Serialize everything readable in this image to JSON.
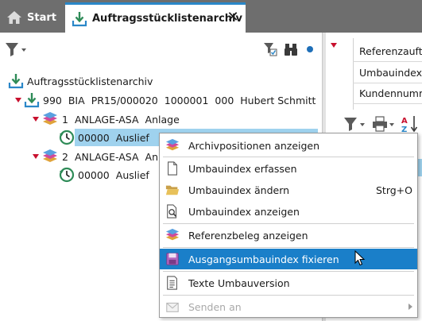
{
  "tabs": [
    {
      "label": "Start",
      "icon": "home-icon"
    },
    {
      "label": "Auftragsstücklistenarchiv",
      "icon": "download-archive-icon",
      "active": true
    }
  ],
  "tree": {
    "root_label": "Auftragsstücklistenarchiv",
    "order_row": {
      "col1": "990",
      "col2": "BIA",
      "col3": "PR15/000020",
      "col4": "1000001",
      "col5": "000",
      "col6": "Hubert Schmitt"
    },
    "positions": [
      {
        "num": "1",
        "code": "ANLAGE-ASA",
        "name": "Anlage",
        "child_num": "00000",
        "child_text": "Auslief"
      },
      {
        "num": "2",
        "code": "ANLAGE-ASA",
        "name": "Anl",
        "child_num": "00000",
        "child_text": "Auslief"
      }
    ]
  },
  "right_pane": {
    "fields": [
      "Referenzauft",
      "Umbauindex",
      "Kundennumm"
    ]
  },
  "context_menu": {
    "items": [
      {
        "label": "Archivpositionen anzeigen",
        "icon": "stack-documents-icon"
      },
      {
        "label": "Umbauindex erfassen",
        "icon": "new-document-icon"
      },
      {
        "label": "Umbauindex ändern",
        "icon": "folder-open-icon",
        "shortcut": "Strg+O"
      },
      {
        "label": "Umbauindex anzeigen",
        "icon": "document-search-icon"
      },
      {
        "label": "Referenzbeleg anzeigen",
        "icon": "stack-documents-icon"
      },
      {
        "label": "Ausgangsumbauindex fixieren",
        "icon": "save-disk-icon",
        "active": true
      },
      {
        "label": "Texte Umbauversion",
        "icon": "text-document-icon"
      },
      {
        "label": "Senden an",
        "icon": "envelope-icon",
        "disabled": true
      }
    ]
  },
  "colors": {
    "tabbar": "#6e6e6e",
    "accent_blue": "#1a7fc9",
    "selection": "#9fd2ee",
    "expand_red": "#c8102e",
    "archive_green": "#2e8b57"
  }
}
